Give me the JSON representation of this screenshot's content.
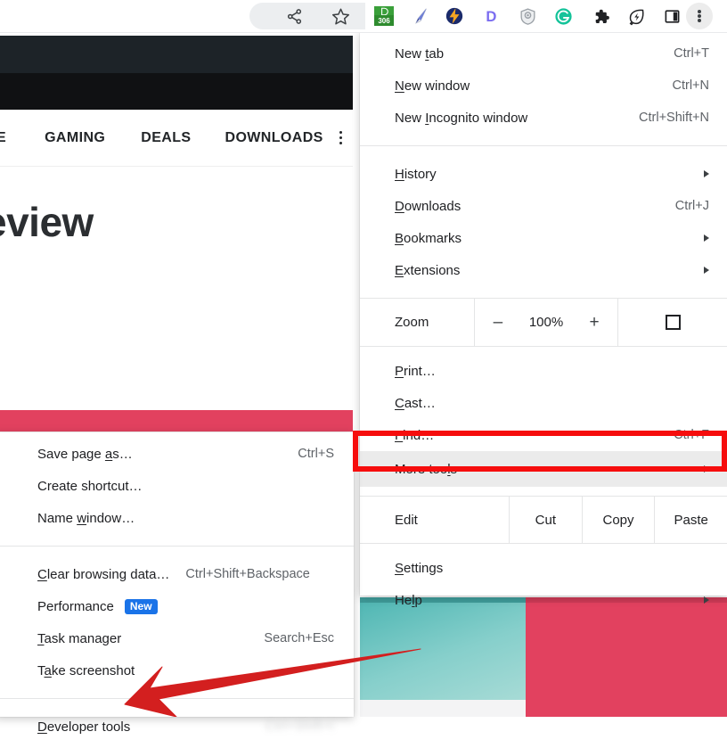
{
  "toolbar": {
    "icons": [
      {
        "name": "share-icon",
        "glyph": "share"
      },
      {
        "name": "bookmark-star-icon",
        "glyph": "star"
      },
      {
        "name": "extension-dashthis-icon",
        "glyph": "badge",
        "badge_count": "306"
      },
      {
        "name": "extension-pen-icon",
        "glyph": "pen"
      },
      {
        "name": "extension-lightning-icon",
        "glyph": "lightning"
      },
      {
        "name": "extension-d-icon",
        "glyph": "D"
      },
      {
        "name": "extension-shield-icon",
        "glyph": "shield"
      },
      {
        "name": "extension-grammarly-icon",
        "glyph": "G"
      },
      {
        "name": "extensions-puzzle-icon",
        "glyph": "puzzle"
      },
      {
        "name": "extension-leaf-icon",
        "glyph": "leaf"
      },
      {
        "name": "side-panel-icon",
        "glyph": "panel"
      },
      {
        "name": "chrome-menu-kebab-icon",
        "glyph": "kebab"
      }
    ]
  },
  "page": {
    "nav_items": [
      "E",
      "GAMING",
      "DEALS",
      "DOWNLOADS"
    ],
    "headline": "eview"
  },
  "chrome_menu": {
    "groups": [
      {
        "items": [
          {
            "name": "new-tab",
            "pre": "New ",
            "u": "t",
            "post": "ab",
            "accel": "Ctrl+T",
            "submenu": false
          },
          {
            "name": "new-window",
            "pre": "",
            "u": "N",
            "post": "ew window",
            "accel": "Ctrl+N",
            "submenu": false
          },
          {
            "name": "new-incognito-window",
            "pre": "New ",
            "u": "I",
            "post": "ncognito window",
            "accel": "Ctrl+Shift+N",
            "submenu": false
          }
        ]
      },
      {
        "items": [
          {
            "name": "history",
            "pre": "",
            "u": "H",
            "post": "istory",
            "accel": "",
            "submenu": true
          },
          {
            "name": "downloads",
            "pre": "",
            "u": "D",
            "post": "ownloads",
            "accel": "Ctrl+J",
            "submenu": false
          },
          {
            "name": "bookmarks",
            "pre": "",
            "u": "B",
            "post": "ookmarks",
            "accel": "",
            "submenu": true
          },
          {
            "name": "extensions",
            "pre": "",
            "u": "E",
            "post": "xtensions",
            "accel": "",
            "submenu": true
          }
        ]
      }
    ],
    "zoom": {
      "label": "Zoom",
      "minus": "–",
      "value": "100%",
      "plus": "+",
      "fullscreen_icon": "fullscreen-icon"
    },
    "group_print": {
      "items": [
        {
          "name": "print",
          "pre": "",
          "u": "P",
          "post": "rint…",
          "accel": "",
          "submenu": false
        },
        {
          "name": "cast",
          "pre": "",
          "u": "C",
          "post": "ast…",
          "accel": "",
          "submenu": false
        },
        {
          "name": "find",
          "pre": "",
          "u": "F",
          "post": "ind…",
          "accel": "Ctrl+F",
          "submenu": false
        },
        {
          "name": "more-tools",
          "pre": "More too",
          "u": "l",
          "post": "s",
          "accel": "",
          "submenu": true,
          "highlighted": true
        }
      ]
    },
    "edit_row": {
      "label": "Edit",
      "actions": [
        "Cut",
        "Copy",
        "Paste"
      ]
    },
    "group_settings": {
      "items": [
        {
          "name": "settings",
          "pre": "",
          "u": "S",
          "post": "ettings",
          "accel": "",
          "submenu": false
        },
        {
          "name": "help",
          "pre": "He",
          "u": "l",
          "post": "p",
          "accel": "",
          "submenu": true
        }
      ]
    }
  },
  "more_tools_submenu": {
    "groups": [
      {
        "items": [
          {
            "name": "save-page-as",
            "pre": "Save page ",
            "u": "a",
            "post": "s…",
            "accel": "Ctrl+S",
            "badge": "",
            "blurred_accel": ""
          },
          {
            "name": "create-shortcut",
            "pre": "Create shortcut…",
            "u": "",
            "post": "",
            "accel": "",
            "badge": "",
            "blurred_accel": ""
          },
          {
            "name": "name-window",
            "pre": "Name ",
            "u": "w",
            "post": "indow…",
            "accel": "",
            "badge": "",
            "blurred_accel": ""
          }
        ]
      },
      {
        "items": [
          {
            "name": "clear-browsing-data",
            "pre": "",
            "u": "C",
            "post": "lear browsing data…",
            "accel": "Ctrl+Shift+Backspace",
            "badge": "",
            "blurred_accel": ""
          },
          {
            "name": "performance",
            "pre": "Performance",
            "u": "",
            "post": "",
            "accel": "",
            "badge": "New",
            "blurred_accel": ""
          },
          {
            "name": "task-manager",
            "pre": "",
            "u": "T",
            "post": "ask manager",
            "accel": "Search+Esc",
            "badge": "",
            "blurred_accel": ""
          },
          {
            "name": "take-screenshot",
            "pre": "T",
            "u": "a",
            "post": "ke screenshot",
            "accel": "",
            "badge": "",
            "blurred_accel": ""
          }
        ]
      },
      {
        "items": [
          {
            "name": "developer-tools",
            "pre": "",
            "u": "D",
            "post": "eveloper tools",
            "accel": "",
            "badge": "",
            "blurred_accel": "Ctrl+Shift+I"
          }
        ]
      }
    ]
  },
  "annotations": {
    "highlight_color": "#f60d0d",
    "arrow_color": "#d31f1f",
    "arrow_name": "red-pointer-arrow",
    "highlight_target": "More tools"
  }
}
